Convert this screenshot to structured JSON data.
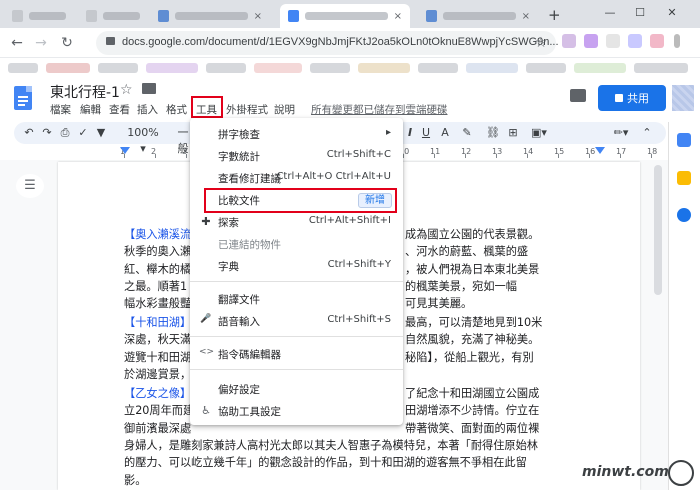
{
  "browser": {
    "url": "docs.google.com/document/d/1EGVX9gNbJmjFKtJ2oa5kOLn0tOknuE8WwpjYcSWG9n...",
    "tab_close": "×",
    "new_tab": "+",
    "win_min": "—",
    "win_max": "☐",
    "win_close": "✕"
  },
  "doc": {
    "title": "東北行程-1",
    "last_edit": "所有變更都已儲存到雲端硬碟",
    "share_label": "共用"
  },
  "menubar": [
    "檔案",
    "編輯",
    "查看",
    "插入",
    "格式",
    "工具",
    "外掛程式",
    "說明"
  ],
  "toolbar": {
    "zoom": "100%",
    "font_size_prefix": "一般"
  },
  "ruler": [
    "1",
    "2",
    "3",
    "4",
    "5",
    "6",
    "7",
    "8",
    "9",
    "10",
    "11",
    "12",
    "13",
    "14",
    "15",
    "16",
    "17",
    "18"
  ],
  "tools_menu": {
    "items": [
      {
        "label": "拼字檢查",
        "shortcut": "▸",
        "icon": ""
      },
      {
        "label": "字數統計",
        "shortcut": "Ctrl+Shift+C",
        "icon": ""
      },
      {
        "label": "查看修訂建議",
        "shortcut": "Ctrl+Alt+O Ctrl+Alt+U",
        "icon": ""
      },
      {
        "label": "比較文件",
        "shortcut": "",
        "icon": ""
      },
      {
        "label": "探索",
        "shortcut": "Ctrl+Alt+Shift+I",
        "icon": "✚"
      },
      {
        "label": "已連結的物件",
        "shortcut": "",
        "icon": ""
      },
      {
        "label": "字典",
        "shortcut": "Ctrl+Shift+Y",
        "icon": ""
      },
      {
        "label": "翻譯文件",
        "shortcut": "",
        "icon": ""
      },
      {
        "label": "語音輸入",
        "shortcut": "Ctrl+Shift+S",
        "icon": "🎤"
      },
      {
        "label": "指令碼編輯器",
        "shortcut": "",
        "icon": "<>"
      },
      {
        "label": "偏好設定",
        "shortcut": "",
        "icon": ""
      },
      {
        "label": "協助工具設定",
        "shortcut": "",
        "icon": "♿"
      }
    ],
    "new_badge": "新增"
  },
  "document_text": {
    "p1": [
      {
        "head": "【奧入瀨溪流",
        "rest": ""
      },
      {
        "head": "",
        "rest": "秋季的奧入瀨"
      },
      {
        "head": "",
        "rest": "紅、櫸木的橘"
      },
      {
        "head": "",
        "rest": "之最。順著1"
      },
      {
        "head": "",
        "rest": "幅水彩畫般豔"
      }
    ],
    "p1_right": [
      "成為國立公園的代表景觀。",
      "、河水的蔚藍、楓葉的盛",
      "，被人們視為日本東北美景",
      "的楓葉美景，宛如一幅",
      "可見其美麗。"
    ],
    "p2": [
      {
        "head": "【十和田湖】",
        "rest": ""
      },
      {
        "head": "",
        "rest": "深處，秋天滿"
      },
      {
        "head": "",
        "rest": "遊覽十和田湖"
      },
      {
        "head": "",
        "rest": "於湖邊賞景，"
      }
    ],
    "p2_right": [
      "最高，可以清楚地見到10米",
      "自然風貌，充滿了神秘美。",
      "秘陷】，從船上觀光，有別",
      ""
    ],
    "p3": [
      {
        "head": "【乙女之像】",
        "rest": ""
      },
      {
        "head": "",
        "rest": "立20周年而建"
      },
      {
        "head": "",
        "rest": "御前濱最深處"
      },
      {
        "head": "",
        "rest": "身婦人，是雕刻家兼詩人高村光太郎以其夫人智惠子為模特兒，本著「耐得住原始林"
      },
      {
        "head": "",
        "rest": "的壓力、可以屹立幾千年」的觀念設計的作品，到十和田湖的遊客無不爭相在此留"
      },
      {
        "head": "",
        "rest": "影。"
      }
    ],
    "p3_right": [
      "了紀念十和田湖國立公園成",
      "田湖增添不少詩情。佇立在",
      "帶著微笑、面對面的兩位裸",
      "",
      "",
      ""
    ]
  },
  "watermark": "minwt.com"
}
